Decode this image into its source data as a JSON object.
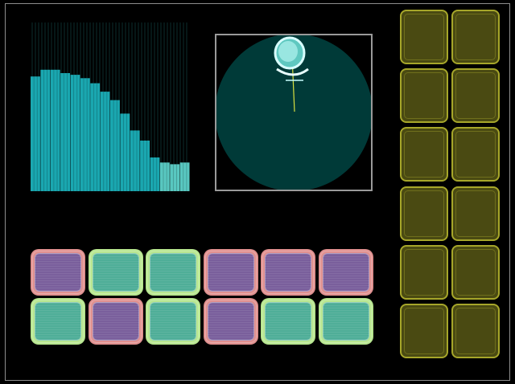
{
  "spectrum": {
    "bar_color": "#1aa7b0",
    "bar_color_light": "#58c7c0",
    "background_line_color": "#0b2e2e",
    "levels": [
      0.68,
      0.72,
      0.72,
      0.7,
      0.69,
      0.67,
      0.64,
      0.59,
      0.54,
      0.46,
      0.36,
      0.3,
      0.2,
      0.17,
      0.16,
      0.17
    ]
  },
  "radar": {
    "disc_color": "#003a38",
    "needle_color": "#d8e040",
    "handle_color": "#c9ffff"
  },
  "pad_rows": [
    [
      "violet",
      "teal",
      "teal",
      "violet",
      "violet",
      "violet"
    ],
    [
      "teal",
      "violet",
      "teal",
      "violet",
      "teal",
      "teal"
    ]
  ],
  "olive_pads": {
    "rows": 6,
    "cols": 2,
    "fill": "#4a4a12",
    "border": "#a6a62a"
  }
}
